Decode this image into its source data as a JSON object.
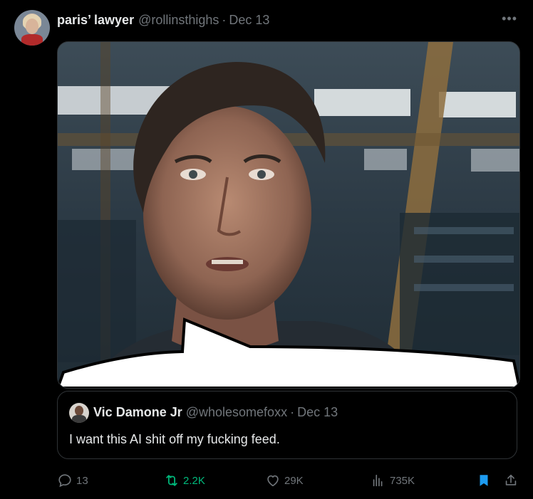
{
  "tweet": {
    "author": {
      "display_name": "paris’ lawyer",
      "handle": "@rollinsthighs",
      "date": "Dec 13"
    },
    "separator": "·",
    "more_label": "•••",
    "media": {
      "description_icon": "photo"
    },
    "quoted_tweet": {
      "display_name": "Vic Damone Jr",
      "handle": "@wholesomefoxx",
      "separator": "·",
      "date": "Dec 13",
      "text": "I want this AI shit off my fucking feed."
    },
    "actions": {
      "replies": "13",
      "retweets": "2.2K",
      "likes": "29K",
      "views": "735K"
    }
  },
  "colors": {
    "background": "#000000",
    "primary_text": "#e7e9ea",
    "secondary_text": "#71767b",
    "border": "#2f3336",
    "retweet_active": "#00ba7c",
    "bookmark_active": "#1d9bf0"
  }
}
